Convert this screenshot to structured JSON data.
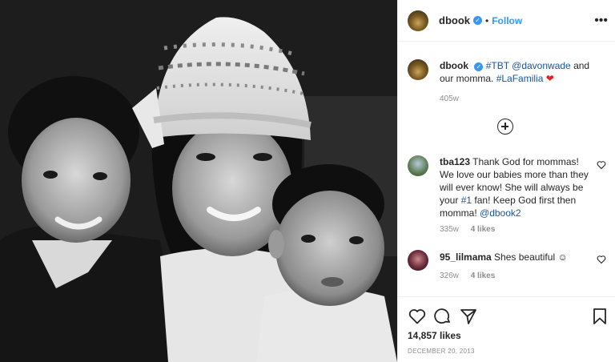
{
  "post": {
    "username": "dbook",
    "follow_label": "Follow",
    "dot": "•",
    "more_label": "•••"
  },
  "caption": {
    "username": "dbook",
    "tag1": "#TBT",
    "mention": "@davonwade",
    "text1": " and our momma. ",
    "tag2": "#LaFamilia",
    "heart": "❤",
    "age": "405w"
  },
  "comments": [
    {
      "username": "tba123",
      "text_a": " Thank God for mommas! We love our babies more than they will ever know! She will always be your ",
      "tag": "#1",
      "text_b": " fan! Keep God first then momma! ",
      "mention": "@dbook2",
      "age": "335w",
      "likes": "4 likes"
    },
    {
      "username": "95_lilmama",
      "text_a": " Shes beautiful ☺",
      "age": "326w",
      "likes": "4 likes"
    }
  ],
  "footer": {
    "likes": "14,857 likes",
    "date": "DECEMBER 20, 2013"
  },
  "colors": {
    "accent": "#3897f0",
    "link": "#1b5393",
    "heart": "#ed1c24",
    "muted": "#8e8e8e"
  },
  "icons": [
    "heart-icon",
    "comment-icon",
    "share-icon",
    "bookmark-icon",
    "add-comment-icon",
    "verified-badge-icon",
    "more-options-icon"
  ]
}
